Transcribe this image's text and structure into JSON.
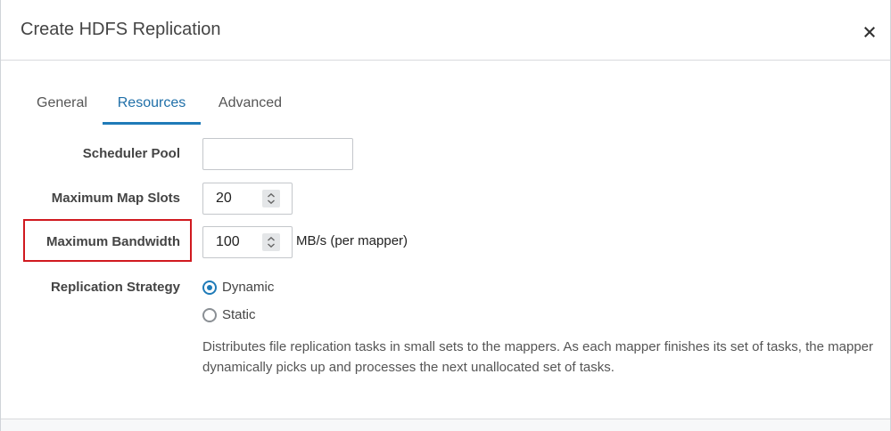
{
  "dialog": {
    "title": "Create HDFS Replication",
    "close_icon": "close-icon"
  },
  "tabs": [
    {
      "label": "General",
      "active": false
    },
    {
      "label": "Resources",
      "active": true
    },
    {
      "label": "Advanced",
      "active": false
    }
  ],
  "form": {
    "scheduler_pool": {
      "label": "Scheduler Pool",
      "value": "",
      "placeholder": ""
    },
    "max_map_slots": {
      "label": "Maximum Map Slots",
      "value": "20",
      "spinner_icon": "chevron-up-down-icon"
    },
    "max_bandwidth": {
      "label": "Maximum Bandwidth",
      "value": "100",
      "unit": "MB/s (per mapper)",
      "spinner_icon": "chevron-up-down-icon",
      "highlighted": true
    },
    "replication_strategy": {
      "label": "Replication Strategy",
      "options": [
        {
          "label": "Dynamic",
          "selected": true
        },
        {
          "label": "Static",
          "selected": false
        }
      ],
      "help": "Distributes file replication tasks in small sets to the mappers. As each mapper finishes its set of tasks, the mapper dynamically picks up and processes the next unallocated set of tasks."
    }
  },
  "colors": {
    "accent": "#1f7bb8",
    "highlight": "#d0191f",
    "border": "#c4c7cb"
  }
}
